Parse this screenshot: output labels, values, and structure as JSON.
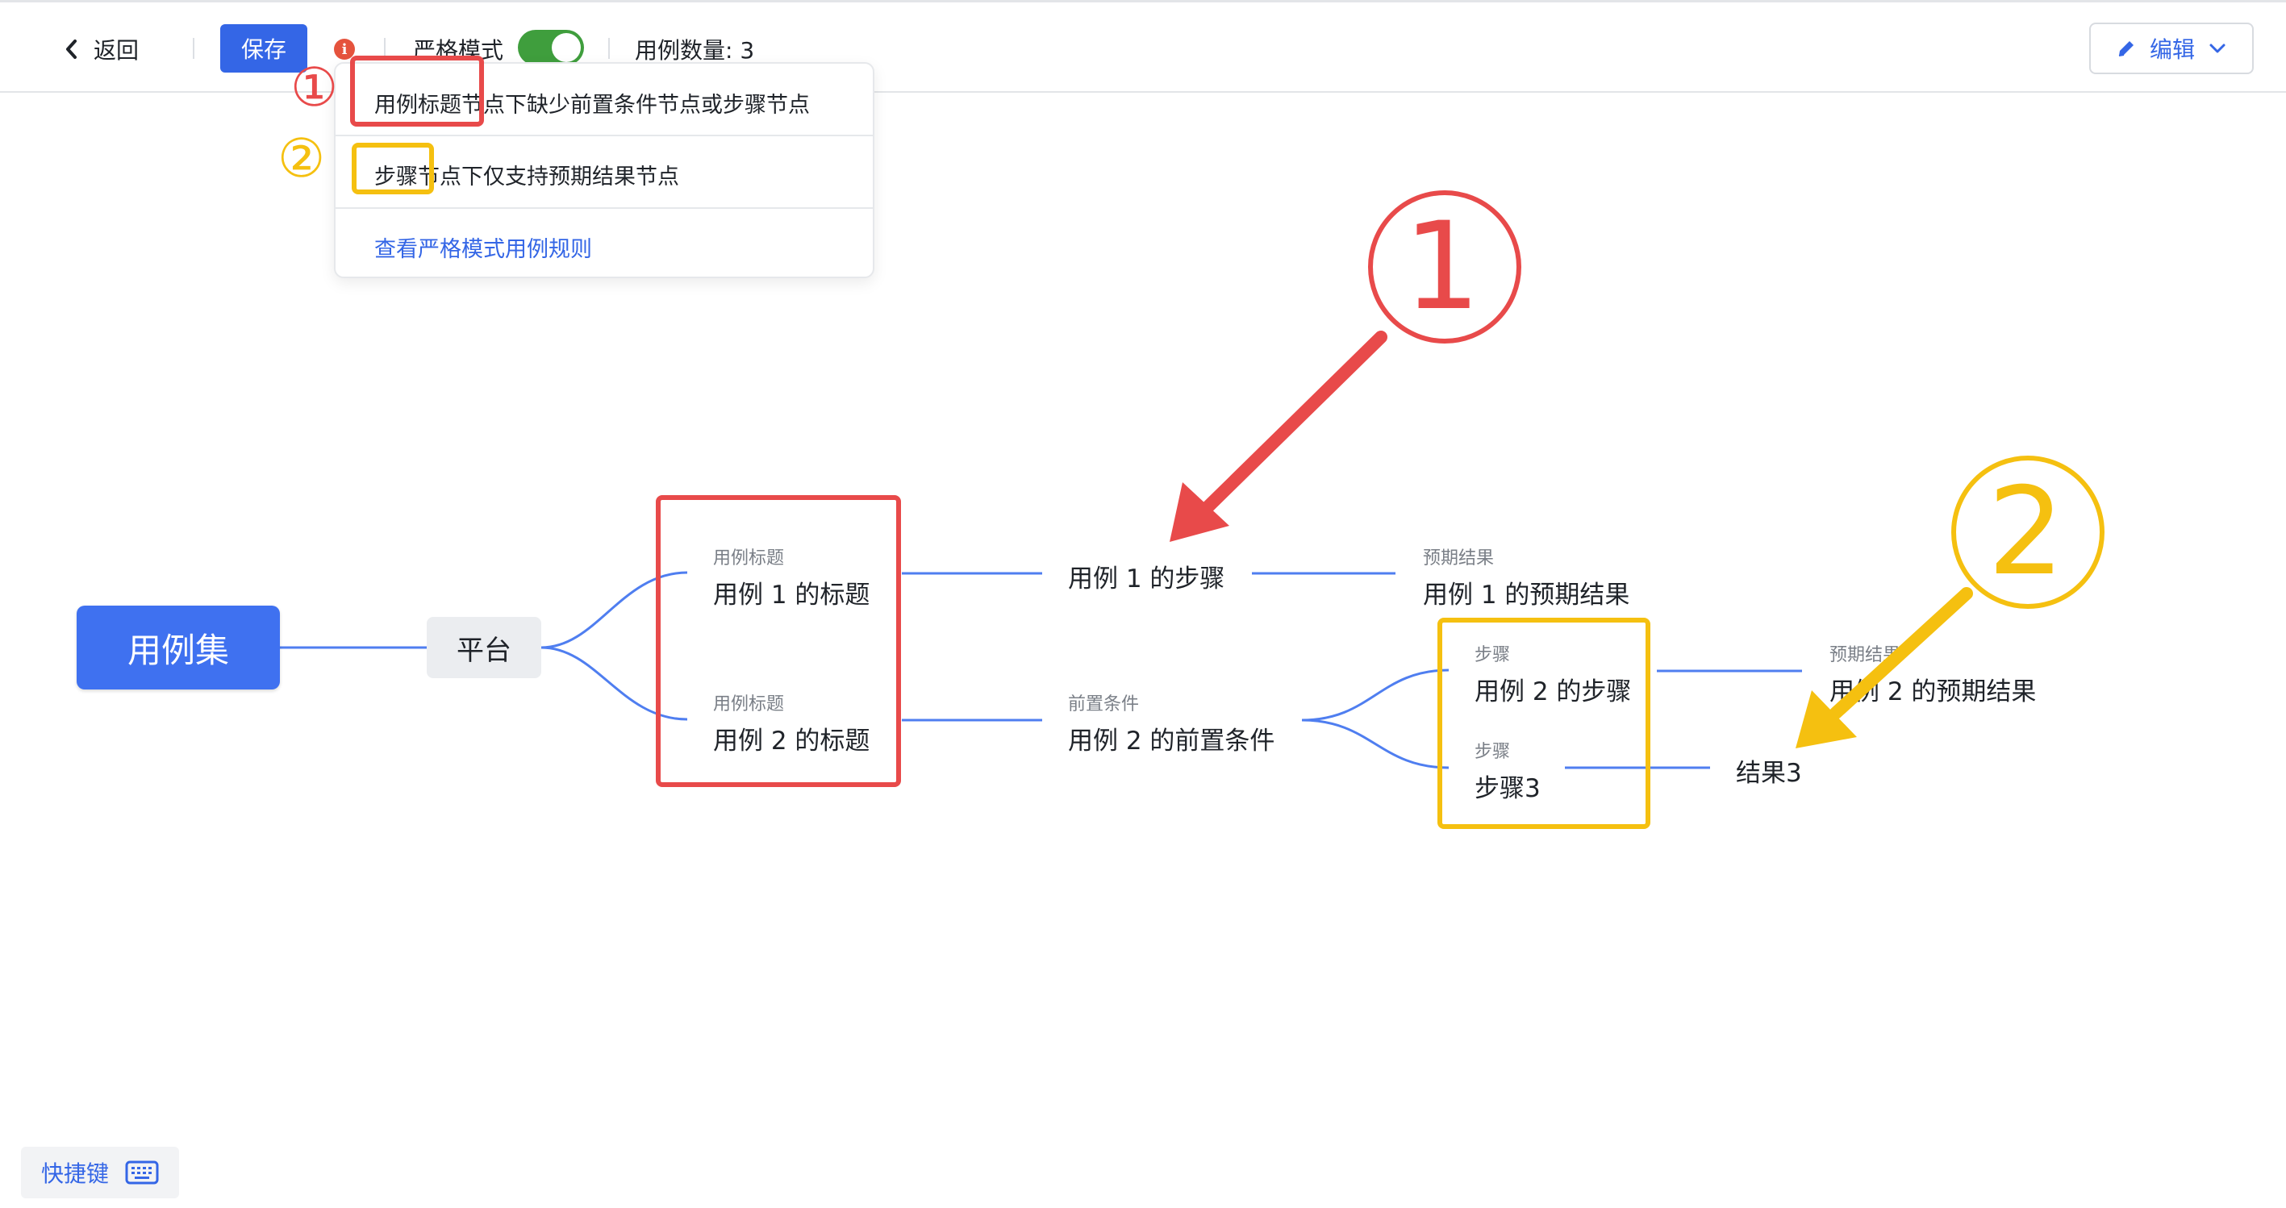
{
  "toolbar": {
    "back_label": "返回",
    "save_label": "保存",
    "info_glyph": "i",
    "strict_mode_label": "严格模式",
    "strict_mode_on": true,
    "case_count_label": "用例数量: 3",
    "edit_label": "编辑"
  },
  "popup": {
    "rule_1": "用例标题节点下缺少前置条件节点或步骤节点",
    "rule_2": "步骤节点下仅支持预期结果节点",
    "view_rules_link": "查看严格模式用例规则"
  },
  "annotations": {
    "marker_1": "①",
    "marker_2": "②",
    "color_1": "#e84a4a",
    "color_2": "#f5c010"
  },
  "mindmap": {
    "root": "用例集",
    "platform": "平台",
    "case1": {
      "tag": "用例标题",
      "title": "用例 1 的标题"
    },
    "case1_step": "用例 1 的步骤",
    "case1_result": {
      "tag": "预期结果",
      "text": "用例 1 的预期结果"
    },
    "case2": {
      "tag": "用例标题",
      "title": "用例 2 的标题"
    },
    "case2_precondition": {
      "tag": "前置条件",
      "text": "用例 2 的前置条件"
    },
    "case2_step": {
      "tag": "步骤",
      "text": "用例 2 的步骤"
    },
    "case2_result": {
      "tag": "预期结果",
      "text": "用例 2 的预期结果"
    },
    "step3": {
      "tag": "步骤",
      "text": "步骤3"
    },
    "result3": "结果3"
  },
  "footer": {
    "shortcut_label": "快捷键"
  },
  "icons": {
    "back": "chevron-left-icon",
    "info": "info-icon",
    "edit": "pencil-icon",
    "dropdown": "chevron-down-icon",
    "shortcut": "keyboard-icon"
  },
  "colors": {
    "primary": "#3466e6",
    "root_node": "#3f71f0",
    "toggle_on": "#3f9e3d",
    "link_line": "#4f7ef0"
  }
}
